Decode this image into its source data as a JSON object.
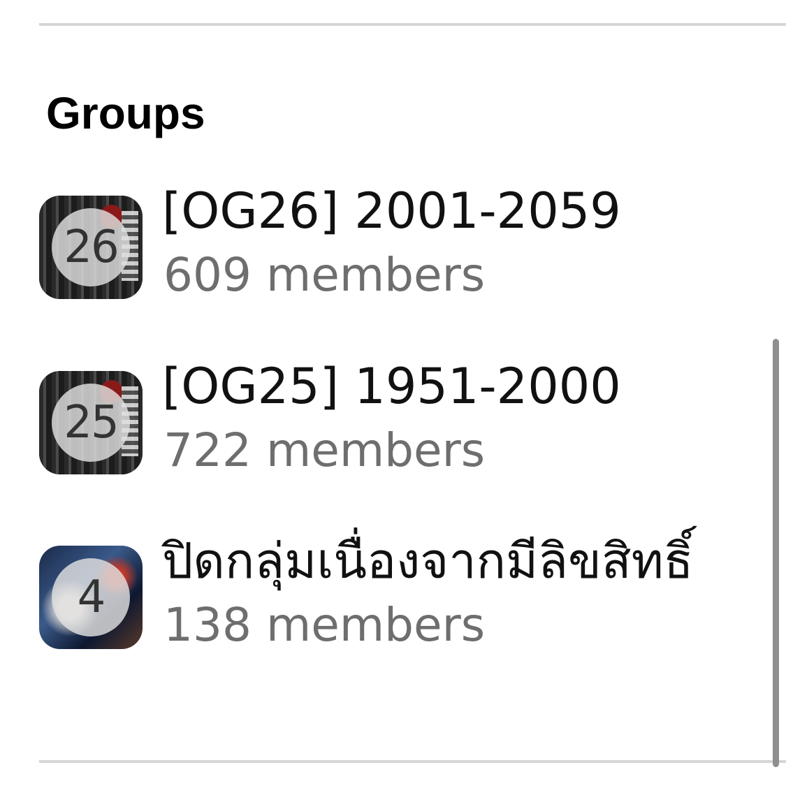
{
  "section": {
    "title": "Groups"
  },
  "groups": [
    {
      "name": "[OG26] 2001-2059",
      "members": "609 members",
      "badge": "26",
      "avatar_style": "dark"
    },
    {
      "name": "[OG25] 1951-2000",
      "members": "722 members",
      "badge": "25",
      "avatar_style": "dark"
    },
    {
      "name": "ปิดกลุ่มเนื่องจากมีลิขสิทธิ์",
      "members": "138 members",
      "badge": "4",
      "avatar_style": "blue"
    }
  ],
  "colors": {
    "title": "#000000",
    "name": "#111111",
    "members": "#6e6e6e",
    "divider": "#d6d6d6",
    "scrollbar": "#8f8f8f"
  }
}
